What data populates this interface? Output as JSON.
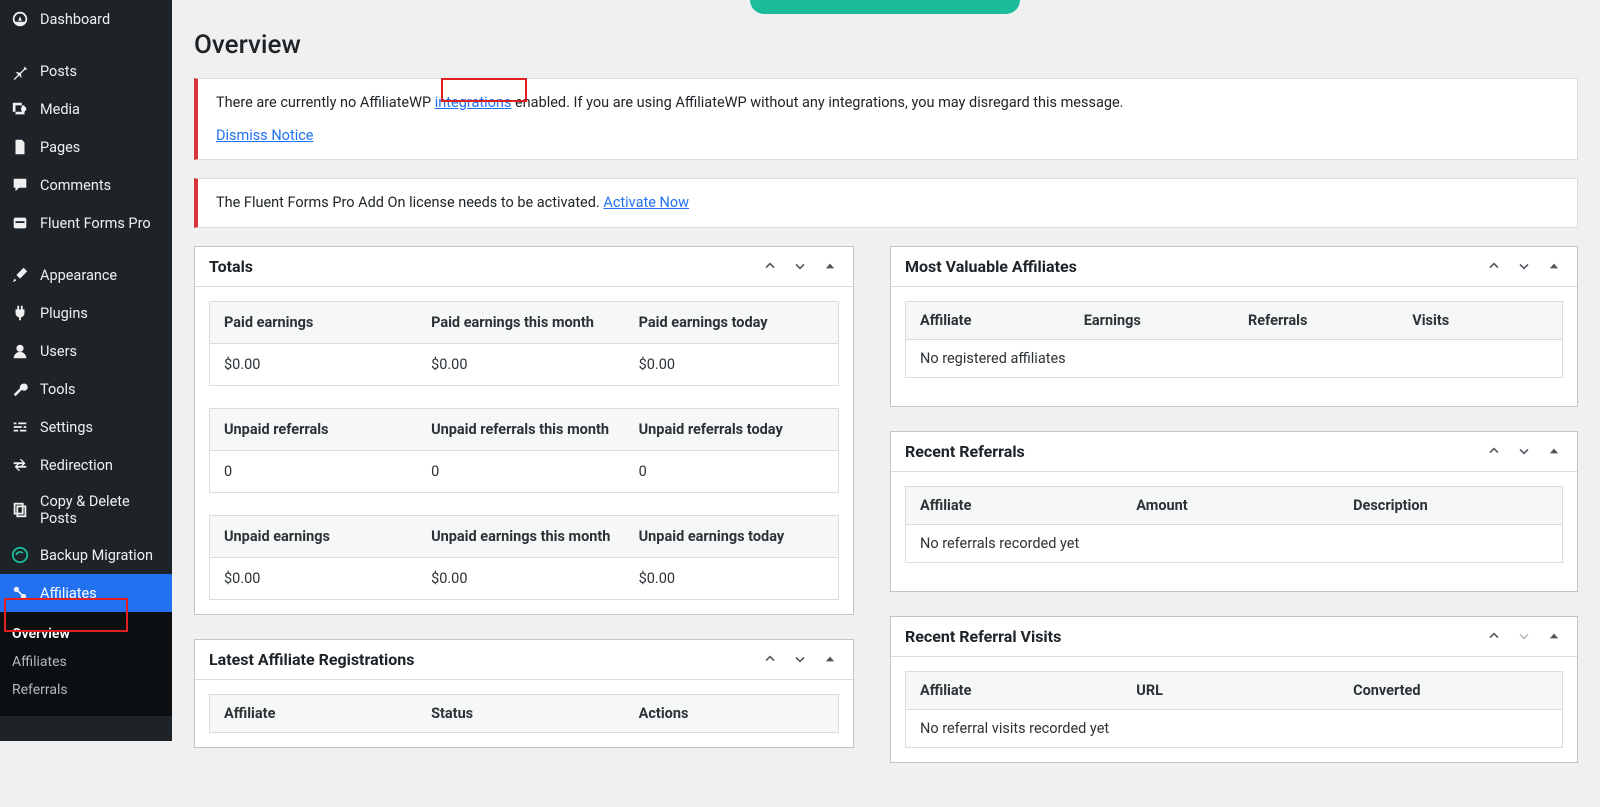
{
  "sidebar": {
    "items": [
      {
        "label": "Dashboard"
      },
      {
        "label": "Posts"
      },
      {
        "label": "Media"
      },
      {
        "label": "Pages"
      },
      {
        "label": "Comments"
      },
      {
        "label": "Fluent Forms Pro"
      },
      {
        "label": "Appearance"
      },
      {
        "label": "Plugins"
      },
      {
        "label": "Users"
      },
      {
        "label": "Tools"
      },
      {
        "label": "Settings"
      },
      {
        "label": "Redirection"
      },
      {
        "label": "Copy & Delete Posts"
      },
      {
        "label": "Backup Migration"
      },
      {
        "label": "Affiliates"
      }
    ],
    "submenu": {
      "overview": "Overview",
      "affiliates": "Affiliates",
      "referrals": "Referrals"
    }
  },
  "page": {
    "title": "Overview"
  },
  "notices": {
    "affwp": {
      "prefix": "There are currently no AffiliateWP ",
      "link": "integrations",
      "suffix": " enabled. If you are using AffiliateWP without any integrations, you may disregard this message.",
      "dismiss": "Dismiss Notice"
    },
    "ff": {
      "text": "The Fluent Forms Pro Add On license needs to be activated. ",
      "link": "Activate Now"
    }
  },
  "totals": {
    "title": "Totals",
    "tables": [
      {
        "headers": [
          "Paid earnings",
          "Paid earnings this month",
          "Paid earnings today"
        ],
        "values": [
          "$0.00",
          "$0.00",
          "$0.00"
        ]
      },
      {
        "headers": [
          "Unpaid referrals",
          "Unpaid referrals this month",
          "Unpaid referrals today"
        ],
        "values": [
          "0",
          "0",
          "0"
        ]
      },
      {
        "headers": [
          "Unpaid earnings",
          "Unpaid earnings this month",
          "Unpaid earnings today"
        ],
        "values": [
          "$0.00",
          "$0.00",
          "$0.00"
        ]
      }
    ]
  },
  "latest_reg": {
    "title": "Latest Affiliate Registrations",
    "headers": [
      "Affiliate",
      "Status",
      "Actions"
    ]
  },
  "mva": {
    "title": "Most Valuable Affiliates",
    "headers": [
      "Affiliate",
      "Earnings",
      "Referrals",
      "Visits"
    ],
    "empty": "No registered affiliates"
  },
  "recent_ref": {
    "title": "Recent Referrals",
    "headers": [
      "Affiliate",
      "Amount",
      "Description"
    ],
    "empty": "No referrals recorded yet"
  },
  "recent_visits": {
    "title": "Recent Referral Visits",
    "headers": [
      "Affiliate",
      "URL",
      "Converted"
    ],
    "empty": "No referral visits recorded yet"
  }
}
